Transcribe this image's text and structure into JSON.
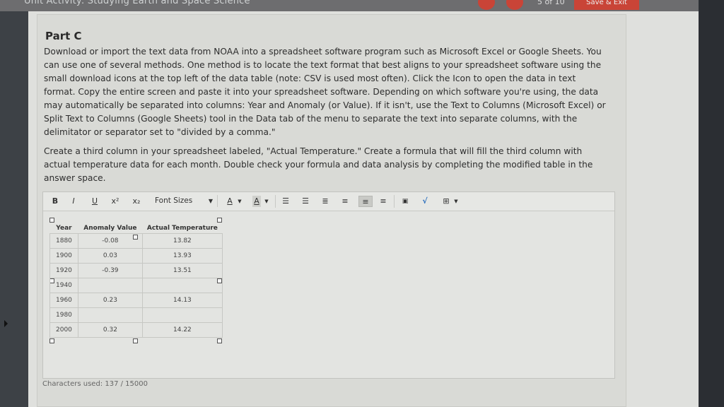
{
  "header": {
    "unit_title": "Unit Activity: Studying Earth and Space Science",
    "page_counter": "5 of 10",
    "save_label": "Save & Exit"
  },
  "part": {
    "title": "Part C",
    "paragraph1": "Download or import the text data from NOAA into a spreadsheet software program such as Microsoft Excel or Google Sheets. You can use one of several methods. One method is to locate the text format that best aligns to your spreadsheet software using the small download icons at the top left of the data table (note: CSV is used most often). Click the Icon to open the data in text format. Copy the entire screen and paste it into your spreadsheet software. Depending on which software you're using, the data may automatically be separated into columns: Year and Anomaly (or Value). If it isn't, use the Text to Columns (Microsoft Excel) or Split Text to Columns (Google Sheets) tool in the Data tab of the menu to separate the text into separate columns, with the delimitator or separator set to \"divided by a comma.\"",
    "paragraph2": "Create a third column in your spreadsheet labeled, \"Actual Temperature.\" Create a formula that will fill the third column with actual temperature data for each month. Double check your formula and data analysis by completing the modified table in the answer space."
  },
  "toolbar": {
    "bold": "B",
    "italic": "I",
    "underline": "U",
    "superscript": "x²",
    "subscript": "x₂",
    "font_sizes": "Font Sizes",
    "font_color": "A",
    "highlight": "A"
  },
  "table": {
    "headers": [
      "Year",
      "Anomaly Value",
      "Actual Temperature"
    ],
    "rows": [
      [
        "1880",
        "-0.08",
        "13.82"
      ],
      [
        "1900",
        "0.03",
        "13.93"
      ],
      [
        "1920",
        "-0.39",
        "13.51"
      ],
      [
        "1940",
        "",
        ""
      ],
      [
        "1960",
        "0.23",
        "14.13"
      ],
      [
        "1980",
        "",
        ""
      ],
      [
        "2000",
        "0.32",
        "14.22"
      ]
    ]
  },
  "footer": {
    "characters_used": "Characters used: 137 / 15000"
  },
  "colors": {
    "accent": "#c94437",
    "page_bg": "#dfe0dd"
  }
}
